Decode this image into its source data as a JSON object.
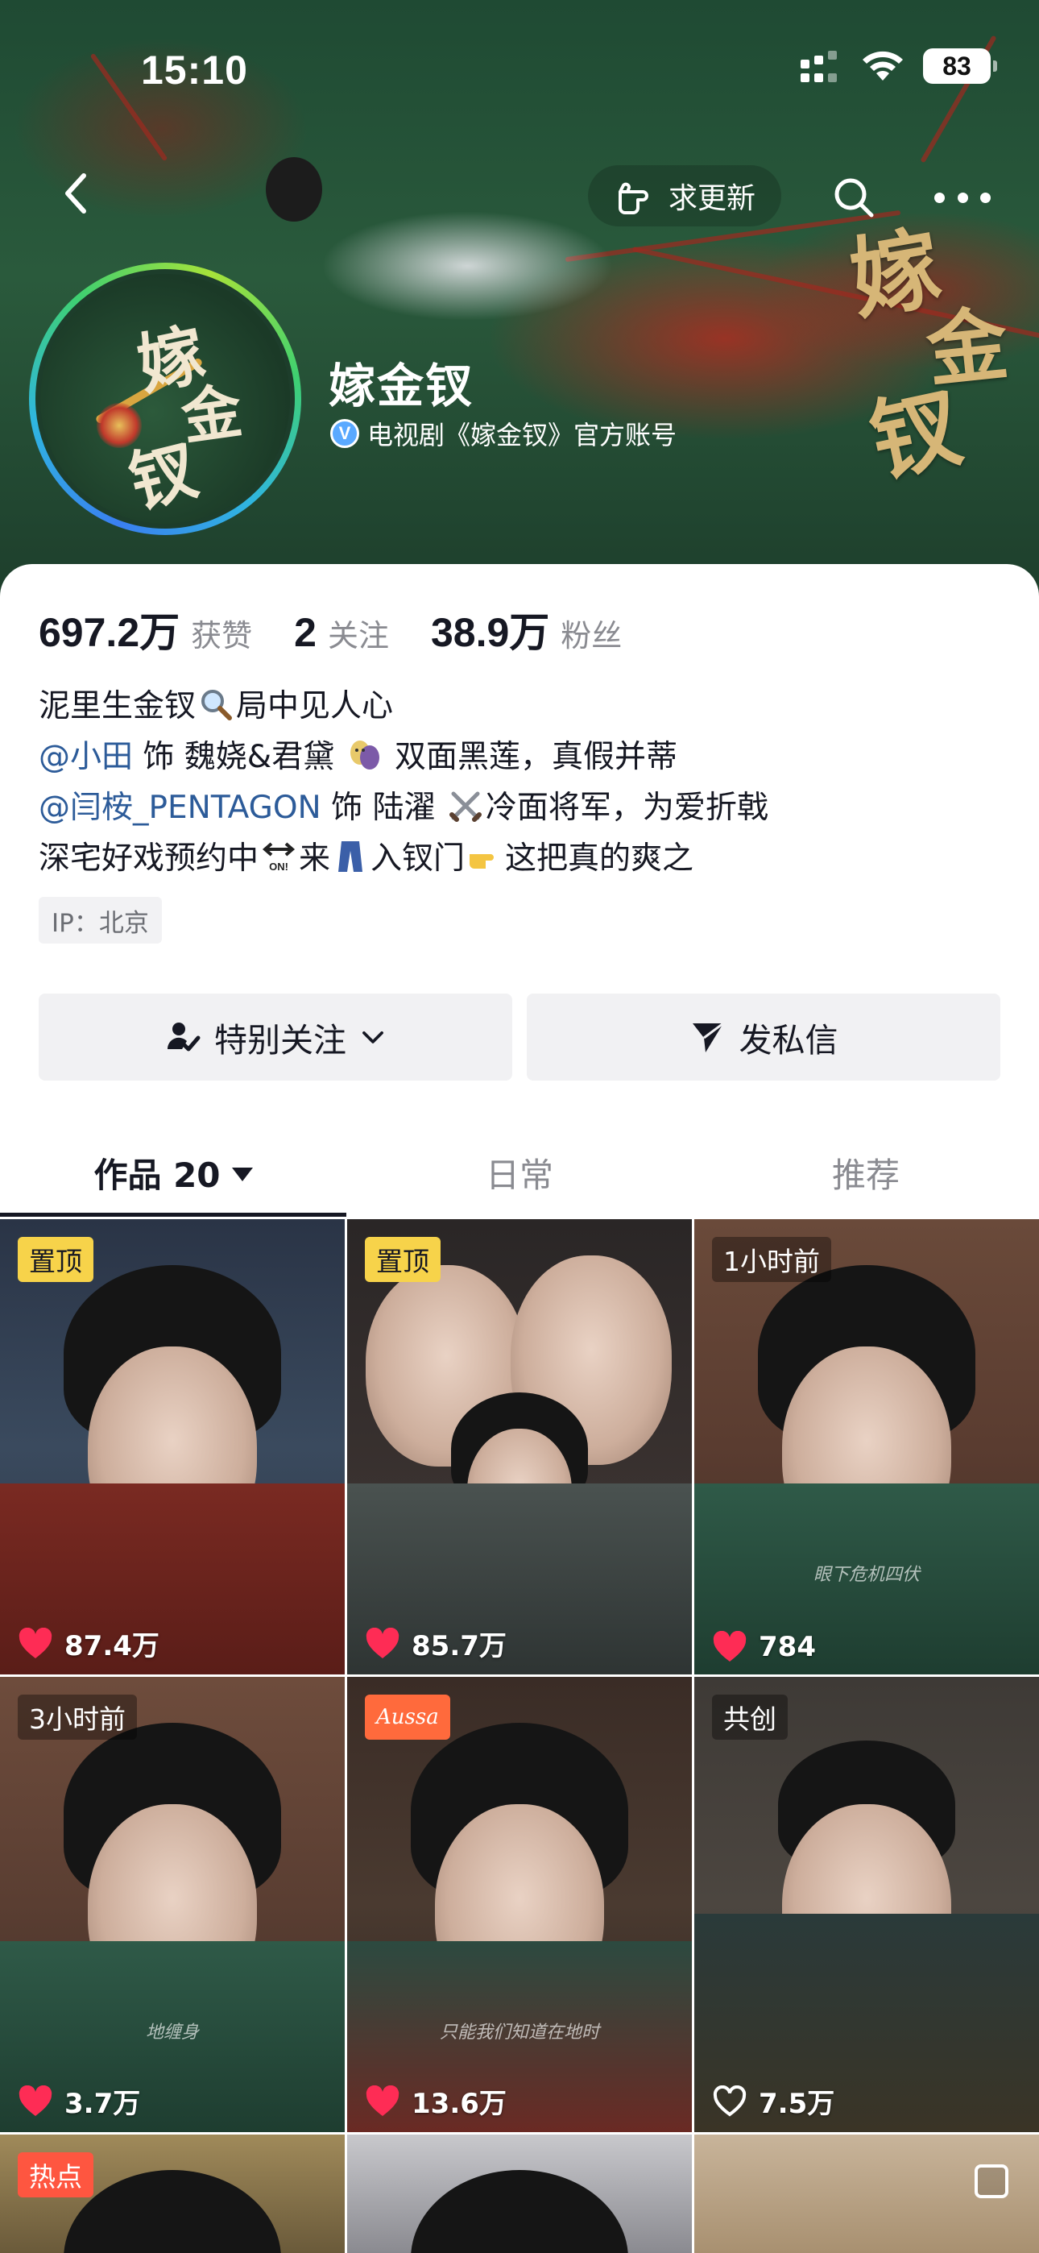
{
  "status": {
    "time": "15:10",
    "battery": "83"
  },
  "header": {
    "request_update_label": "求更新",
    "deco_chars": [
      "嫁",
      "金",
      "钗"
    ]
  },
  "profile": {
    "avatar_chars": [
      "嫁",
      "金",
      "钗"
    ],
    "name": "嫁金钗",
    "verified_badge": "V",
    "verification": "电视剧《嫁金钗》官方账号"
  },
  "stats": [
    {
      "value": "697.2万",
      "label": "获赞"
    },
    {
      "value": "2",
      "label": "关注"
    },
    {
      "value": "38.9万",
      "label": "粉丝"
    }
  ],
  "bio": {
    "line1": {
      "a": "泥里生金钗",
      "b": "局中见人心"
    },
    "line2": {
      "mention": "@小田",
      "a": " 饰 魏娆&君黛 ",
      "b": " 双面黑莲，真假并蒂"
    },
    "line3": {
      "mention": "@闫桉_PENTAGON",
      "a": " 饰 陆濯 ",
      "b": "冷面将军，为爱折戟"
    },
    "line4": {
      "a": "深宅好戏预约中",
      "b": "来",
      "c": "入钗门",
      "d": "这把真的爽之"
    }
  },
  "ip_label": "IP：北京",
  "buttons": {
    "follow": "特别关注",
    "message": "发私信"
  },
  "tabs": [
    {
      "label": "作品 20"
    },
    {
      "label": "日常"
    },
    {
      "label": "推荐"
    }
  ],
  "videos": [
    {
      "badge": "置顶",
      "likes": "87.4万",
      "caption": ""
    },
    {
      "badge": "置顶",
      "likes": "85.7万",
      "caption": ""
    },
    {
      "badge": "1小时前",
      "likes": "784",
      "caption": "眼下危机四伏"
    },
    {
      "badge": "3小时前",
      "likes": "3.7万",
      "caption": "地缠身"
    },
    {
      "badge": "Aussa",
      "likes": "13.6万",
      "caption": "只能我们知道在地时"
    },
    {
      "badge": "共创",
      "likes": "7.5万",
      "caption": ""
    },
    {
      "badge": "热点",
      "likes": "",
      "caption": ""
    }
  ],
  "colors": {
    "mention": "#2c5b99",
    "pin_badge": "#f7d34a",
    "hot_badge": "#fe5640"
  }
}
